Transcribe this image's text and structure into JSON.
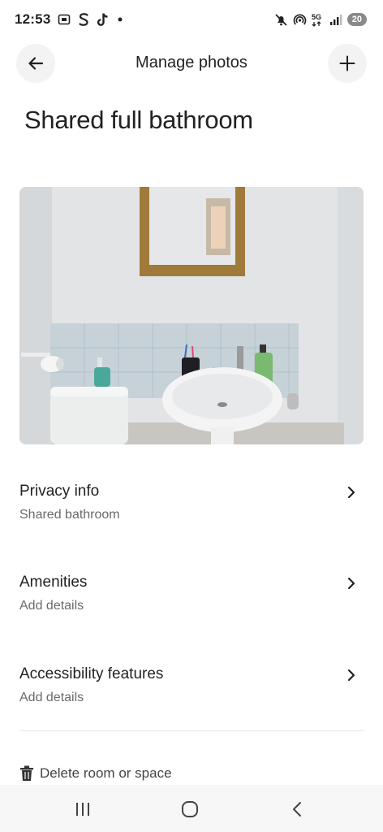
{
  "status_bar": {
    "time": "12:53",
    "battery": "20",
    "icons": [
      "screenshot-icon",
      "s-app-icon",
      "tiktok-icon",
      "dot-icon",
      "mute-icon",
      "hotspot-icon",
      "5g-icon",
      "signal-icon",
      "battery-icon"
    ]
  },
  "header": {
    "title": "Manage photos",
    "back_icon": "arrow-left-icon",
    "add_icon": "plus-icon"
  },
  "page": {
    "title": "Shared full bathroom"
  },
  "photo": {
    "description": "bathroom-photo"
  },
  "rows": [
    {
      "title": "Privacy info",
      "subtitle": "Shared bathroom"
    },
    {
      "title": "Amenities",
      "subtitle": "Add details"
    },
    {
      "title": "Accessibility features",
      "subtitle": "Add details"
    }
  ],
  "delete": {
    "label": "Delete room or space",
    "icon": "trash-icon"
  },
  "nav": {
    "icons": [
      "recent-apps-icon",
      "home-icon",
      "back-icon"
    ]
  },
  "colors": {
    "text": "#222222",
    "subtext": "#6a6a6a",
    "button_bg": "#f3f3f3",
    "divider": "#e6e6e6"
  }
}
